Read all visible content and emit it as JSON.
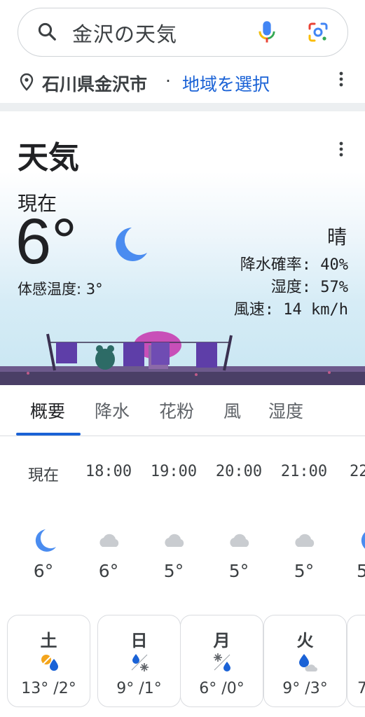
{
  "search": {
    "query": "金沢の天気"
  },
  "location": {
    "city": "石川県金沢市",
    "separator": "·",
    "select_label": "地域を選択"
  },
  "card": {
    "title": "天気",
    "now_label": "現在",
    "temperature": "6°",
    "feels_like": "体感温度: 3°",
    "condition": "晴",
    "precip": "降水確率: 40%",
    "humidity": "湿度: 57%",
    "wind": "風速: 14 km/h"
  },
  "tabs": [
    {
      "label": "概要",
      "active": true
    },
    {
      "label": "降水",
      "active": false
    },
    {
      "label": "花粉",
      "active": false
    },
    {
      "label": "風",
      "active": false
    },
    {
      "label": "湿度",
      "active": false
    }
  ],
  "hourly": [
    {
      "time": "現在",
      "temp": "6°",
      "icon": "moon-icon"
    },
    {
      "time": "18:00",
      "temp": "6°",
      "icon": "cloud-icon"
    },
    {
      "time": "19:00",
      "temp": "5°",
      "icon": "cloud-icon"
    },
    {
      "time": "20:00",
      "temp": "5°",
      "icon": "cloud-icon"
    },
    {
      "time": "21:00",
      "temp": "5°",
      "icon": "cloud-icon"
    },
    {
      "time": "22",
      "temp": "5",
      "icon": "moon-icon"
    }
  ],
  "daily": [
    {
      "day": "土",
      "temps": "13° /2°",
      "icon": "sun-rain-icon"
    },
    {
      "day": "日",
      "temps": "9° /1°",
      "icon": "rain-snow-icon"
    },
    {
      "day": "月",
      "temps": "6° /0°",
      "icon": "snow-rain-icon"
    },
    {
      "day": "火",
      "temps": "9° /3°",
      "icon": "rain-cloud-icon"
    },
    {
      "day": "",
      "temps": "7",
      "icon": ""
    }
  ],
  "colors": {
    "accent": "#1a62d6",
    "moon": "#4a8cf0",
    "cloud": "#c9ccd0"
  }
}
